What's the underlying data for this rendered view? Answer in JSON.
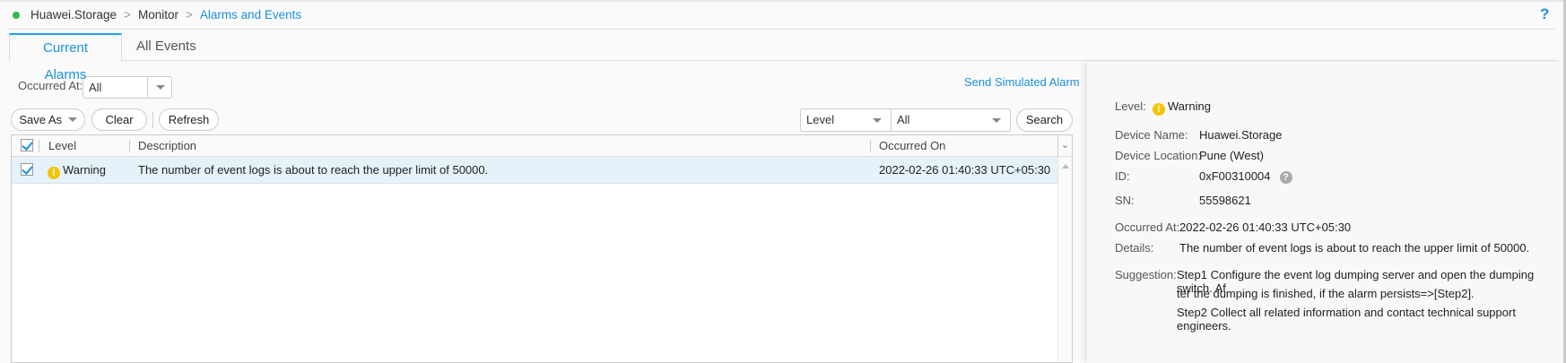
{
  "breadcrumb": {
    "items": [
      "Huawei.Storage",
      "Monitor",
      "Alarms and Events"
    ]
  },
  "help_label": "?",
  "tabs": [
    {
      "label": "Current Alarms",
      "active": true
    },
    {
      "label": "All Events",
      "active": false
    }
  ],
  "filters": {
    "occurred_at_label": "Occurred At:",
    "occurred_at_value": "All",
    "send_simulated_alarm": "Send Simulated Alarm",
    "level_field": "Level",
    "level_value": "All",
    "search_label": "Search"
  },
  "toolbar": {
    "save_as": "Save As",
    "clear": "Clear",
    "refresh": "Refresh"
  },
  "table": {
    "columns": [
      "Level",
      "Description",
      "Occurred On"
    ],
    "rows": [
      {
        "checked": true,
        "level": "Warning",
        "description": "The number of event logs is about to reach the upper limit of 50000.",
        "occurred_on": "2022-02-26 01:40:33 UTC+05:30"
      }
    ]
  },
  "details": {
    "level_label": "Level:",
    "level_value": "Warning",
    "device_name_label": "Device Name:",
    "device_name": "Huawei.Storage",
    "device_location_label": "Device Location:",
    "device_location": "Pune (West)",
    "id_label": "ID:",
    "id": "0xF00310004",
    "sn_label": "SN:",
    "sn": "55598621",
    "occurred_at_label": "Occurred At:",
    "occurred_at": "2022-02-26 01:40:33 UTC+05:30",
    "details_label": "Details:",
    "details": "The number of event logs is about to reach the upper limit of 50000.",
    "suggestion_label": "Suggestion:",
    "suggestion_lines": [
      "Step1 Configure the event log dumping server and open the dumping switch. Af",
      "ter the dumping is finished, if the alarm persists=>[Step2].",
      "Step2 Collect all related information and contact technical support engineers."
    ]
  },
  "colors": {
    "accent": "#1a90e0",
    "warning": "#f5c400",
    "status_ok": "#2db84d"
  }
}
